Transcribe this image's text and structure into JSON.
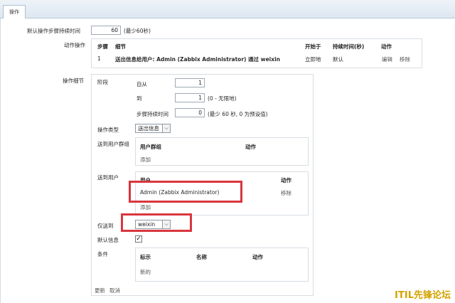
{
  "tab": {
    "label": "操作"
  },
  "default_duration": {
    "label": "默认操作步骤持续时间",
    "value": "60",
    "hint": "(最少60秒)"
  },
  "actions": {
    "label": "动作操作",
    "headers": [
      "步骤",
      "细节",
      "开始于",
      "持续时间(秒)",
      "动作"
    ],
    "row": {
      "step": "1",
      "detail": "送出信息给用户: Admin (Zabbix Administrator) 通过 weixin",
      "start": "立即地",
      "duration": "默认",
      "edit": "编辑",
      "remove": "移除"
    }
  },
  "op_details": {
    "label": "操作细节",
    "stage_label": "阶段",
    "from_label": "自从",
    "from_value": "1",
    "to_label": "到",
    "to_value": "1",
    "to_hint": "(0 - 无限地)",
    "step_duration_label": "步骤持续时间",
    "step_duration_value": "0",
    "step_duration_hint": "(最少 60 秒, 0 为预设值)",
    "op_type_label": "操作类型",
    "op_type_value": "送出信息",
    "send_groups_label": "送到用户群组",
    "groups_headers": [
      "用户群组",
      "动作"
    ],
    "groups_add": "添加",
    "send_users_label": "送到用户",
    "users_headers": [
      "用户",
      "动作"
    ],
    "user_name": "Admin (Zabbix Administrator)",
    "user_remove": "移除",
    "users_add": "添加",
    "send_only_label": "仅送到",
    "send_only_value": "weixin",
    "default_msg_label": "默认信息",
    "default_msg_checked": true,
    "conditions_label": "条件",
    "conditions_headers": [
      "标示",
      "名称",
      "动作"
    ],
    "conditions_new": "新的",
    "update": "更新",
    "cancel": "取消"
  },
  "watermark": "ITIL先锋论坛",
  "colors": {
    "highlight": "#d9363e",
    "watermark": "#d4a300"
  }
}
